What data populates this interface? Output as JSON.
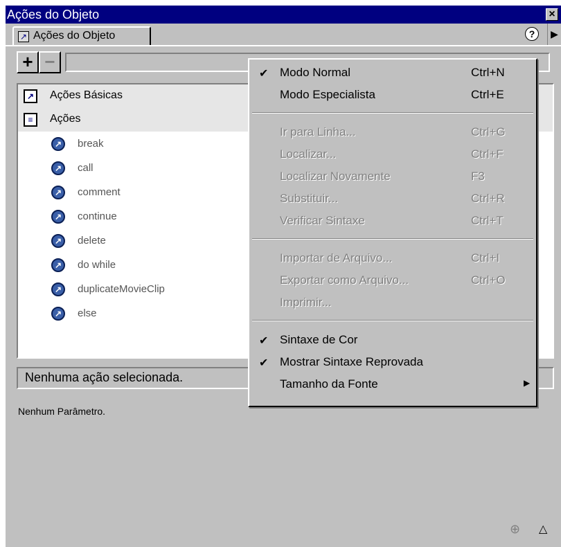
{
  "window": {
    "title": "Ações do Objeto",
    "close_icon": "close-icon"
  },
  "tab": {
    "label": "Ações do Objeto"
  },
  "help_glyph": "?",
  "toolbar": {
    "add_glyph": "+",
    "remove_glyph": "−"
  },
  "actions": {
    "categories": [
      {
        "label": "Ações Básicas",
        "icon": "arrow-book-icon"
      },
      {
        "label": "Ações",
        "icon": "list-book-icon"
      }
    ],
    "items": [
      "break",
      "call",
      "comment",
      "continue",
      "delete",
      "do while",
      "duplicateMovieClip",
      "else"
    ]
  },
  "status": {
    "text": "Nenhuma ação selecionada."
  },
  "params": {
    "text": "Nenhum Parâmetro."
  },
  "menu": {
    "groups": [
      [
        {
          "label": "Modo Normal",
          "shortcut": "Ctrl+N",
          "checked": true,
          "disabled": false
        },
        {
          "label": "Modo Especialista",
          "shortcut": "Ctrl+E",
          "checked": false,
          "disabled": false
        }
      ],
      [
        {
          "label": "Ir para Linha...",
          "shortcut": "Ctrl+G",
          "checked": false,
          "disabled": true
        },
        {
          "label": "Localizar...",
          "shortcut": "Ctrl+F",
          "checked": false,
          "disabled": true
        },
        {
          "label": "Localizar Novamente",
          "shortcut": "F3",
          "checked": false,
          "disabled": true
        },
        {
          "label": "Substituir...",
          "shortcut": "Ctrl+R",
          "checked": false,
          "disabled": true
        },
        {
          "label": "Verificar Sintaxe",
          "shortcut": "Ctrl+T",
          "checked": false,
          "disabled": true
        }
      ],
      [
        {
          "label": "Importar de Arquivo...",
          "shortcut": "Ctrl+I",
          "checked": false,
          "disabled": true
        },
        {
          "label": "Exportar como Arquivo...",
          "shortcut": "Ctrl+O",
          "checked": false,
          "disabled": true
        },
        {
          "label": "Imprimir...",
          "shortcut": "",
          "checked": false,
          "disabled": true
        }
      ],
      [
        {
          "label": "Sintaxe de Cor",
          "shortcut": "",
          "checked": true,
          "disabled": false
        },
        {
          "label": "Mostrar Sintaxe Reprovada",
          "shortcut": "",
          "checked": true,
          "disabled": false
        },
        {
          "label": "Tamanho da Fonte",
          "shortcut": "",
          "checked": false,
          "disabled": false,
          "submenu": true
        }
      ]
    ]
  },
  "colors": {
    "titlebar": "#000080",
    "face": "#c0c0c0",
    "disabled_text": "#808080"
  }
}
